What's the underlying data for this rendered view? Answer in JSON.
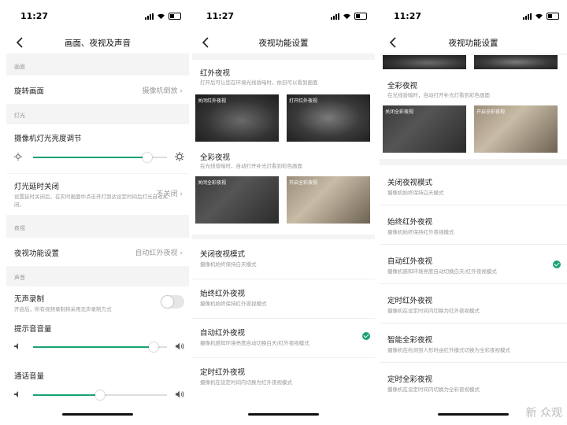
{
  "status": {
    "time": "11:27"
  },
  "p1": {
    "title": "画面、夜视及声音",
    "sec_screen": "画面",
    "rotate_title": "旋转画面",
    "rotate_value": "摄像机倒放",
    "sec_light": "灯光",
    "brightness_title": "摄像机灯光亮度调节",
    "brightness_level": 0.85,
    "delay_title": "灯光延时关闭",
    "delay_value": "不关闭",
    "delay_sub": "设置延时关闭后，在实时画面中点击开灯到达设定时间后灯光自动关闭。",
    "sec_night": "夜视",
    "night_title": "夜视功能设置",
    "night_value": "自动红外夜视",
    "sec_sound": "声音",
    "mute_title": "无声录制",
    "mute_sub": "开启后，所有视频录制将采用无声录制方式",
    "prompt_title": "提示音音量",
    "prompt_level": 0.9,
    "call_title": "通话音量",
    "call_level": 0.5
  },
  "p2": {
    "title": "夜视功能设置",
    "ir_title": "红外夜视",
    "ir_sub": "打开后可让您在环境光线昏暗时，依旧可以看到画面",
    "ir_off_label": "关闭红外夜视",
    "ir_on_label": "打开红外夜视",
    "color_title": "全彩夜视",
    "color_sub": "在光线昏暗时，自动打开补光灯看到彩色画面",
    "color_off_label": "关闭全彩夜视",
    "color_on_label": "开启全彩夜视",
    "opt1_title": "关闭夜视模式",
    "opt1_sub": "摄像机始终保持白天模式",
    "opt2_title": "始终红外夜视",
    "opt2_sub": "摄像机始终保持红外夜视模式",
    "opt3_title": "自动红外夜视",
    "opt3_sub": "摄像机感知环境亮度自动切换白天/红外夜视模式",
    "opt4_title": "定时红外夜视",
    "opt4_sub": "摄像机在设定时间内切换为红外夜视模式"
  },
  "p3": {
    "title": "夜视功能设置",
    "color_title": "全彩夜视",
    "color_sub": "在光线昏暗时，自动打开补光灯看到彩色画面",
    "color_off_label": "关闭全彩夜视",
    "color_on_label": "开启全彩夜视",
    "opt1_title": "关闭夜视模式",
    "opt1_sub": "摄像机始终保持白天模式",
    "opt2_title": "始终红外夜视",
    "opt2_sub": "摄像机始终保持红外夜视模式",
    "opt3_title": "自动红外夜视",
    "opt3_sub": "摄像机感知环境亮度自动切换白天/红外夜视模式",
    "opt4_title": "定时红外夜视",
    "opt4_sub": "摄像机在设定时间内切换为红外夜视模式",
    "opt5_title": "智能全彩夜视",
    "opt5_sub": "摄像机在检测到人形时由红外模式切换为全彩夜视模式",
    "opt6_title": "定时全彩夜视",
    "opt6_sub": "摄像机在设定时间内切换为全彩夜视模式"
  },
  "watermark": "新 众观",
  "colors": {
    "accent": "#1aa36f"
  }
}
